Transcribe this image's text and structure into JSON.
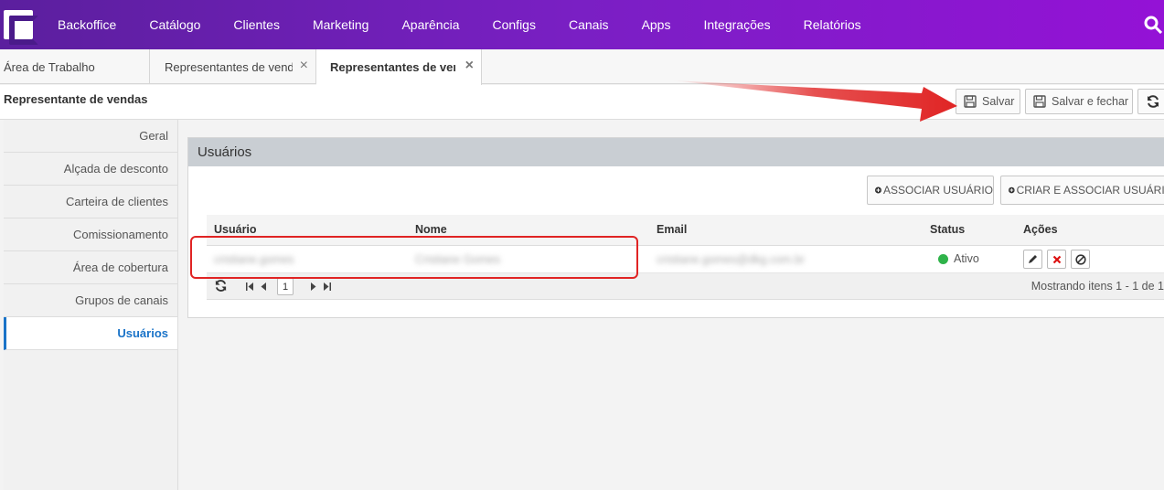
{
  "nav": {
    "items": [
      "Backoffice",
      "Catálogo",
      "Clientes",
      "Marketing",
      "Aparência",
      "Configs",
      "Canais",
      "Apps",
      "Integrações",
      "Relatórios"
    ]
  },
  "tabs": {
    "workspace": "Área de Trabalho",
    "tab1": "Representantes de vendas",
    "tab2": "Representantes de vendas",
    "close_glyph": "×"
  },
  "header": {
    "title": "Representante de vendas",
    "save": "Salvar",
    "save_close": "Salvar e fechar"
  },
  "side": {
    "items": [
      "Geral",
      "Alçada de desconto",
      "Carteira de clientes",
      "Comissionamento",
      "Área de cobertura",
      "Grupos de canais",
      "Usuários"
    ],
    "active": "Usuários"
  },
  "panel": {
    "title": "Usuários",
    "associate": "ASSOCIAR USUÁRIO",
    "create_associate": "CRIAR E ASSOCIAR USUÁRIO"
  },
  "grid": {
    "columns": [
      "Usuário",
      "Nome",
      "Email",
      "Status",
      "Ações"
    ],
    "rows": [
      {
        "user": "cristiane.gomes",
        "name": "Cristiane Gomes",
        "email": "cristiane.gomes@dkg.com.br",
        "status": "Ativo"
      }
    ],
    "page": "1",
    "info": "Mostrando itens 1 - 1 de 1"
  },
  "colors": {
    "nav_start": "#5b1f9e",
    "nav_end": "#9412d6",
    "accent": "#1a73c8",
    "status_active": "#2fb34a",
    "annotation": "#e02424"
  }
}
